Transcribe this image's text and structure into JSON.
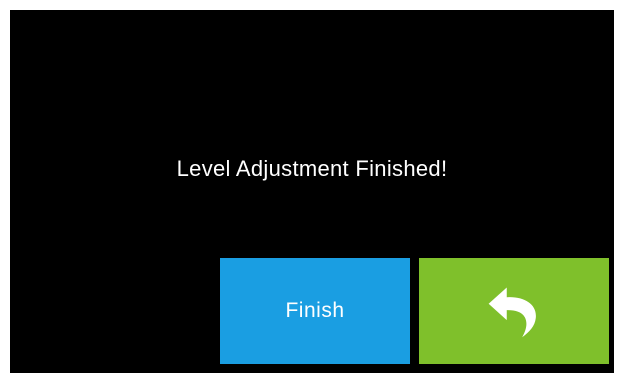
{
  "dialog": {
    "message": "Level Adjustment Finished!"
  },
  "buttons": {
    "finish_label": "Finish",
    "back_icon": "return-arrow-icon"
  },
  "colors": {
    "background": "#000000",
    "finish_button": "#1a9ee2",
    "back_button": "#7fc02b",
    "text": "#ffffff"
  }
}
